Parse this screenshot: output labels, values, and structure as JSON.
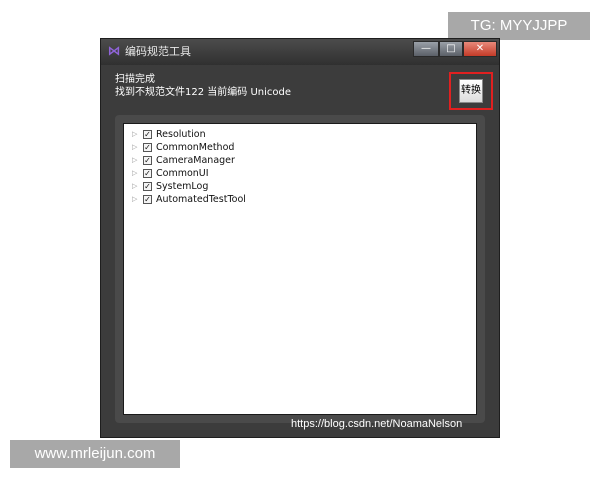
{
  "watermarks": {
    "top": "TG: MYYJJPP",
    "bottom": "www.mrleijun.com",
    "csdn": "https://blog.csdn.net/NoamaNelson"
  },
  "window": {
    "title": "编码规范工具",
    "controls": {
      "minimize": "—",
      "maximize": "□",
      "close": "✕"
    },
    "app_icon": "visual-studio-icon"
  },
  "status": {
    "line1": "扫描完成",
    "line2": "找到不规范文件122 当前编码 Unicode"
  },
  "toolbar": {
    "convert_label": "转换"
  },
  "tree": {
    "items": [
      {
        "label": "Resolution",
        "checked": true
      },
      {
        "label": "CommonMethod",
        "checked": true
      },
      {
        "label": "CameraManager",
        "checked": true
      },
      {
        "label": "CommonUI",
        "checked": true
      },
      {
        "label": "SystemLog",
        "checked": true
      },
      {
        "label": "AutomatedTestTool",
        "checked": true
      }
    ]
  },
  "colors": {
    "window_bg": "#3c3c3c",
    "highlight": "#e02020",
    "icon_purple": "#8f64d8"
  }
}
